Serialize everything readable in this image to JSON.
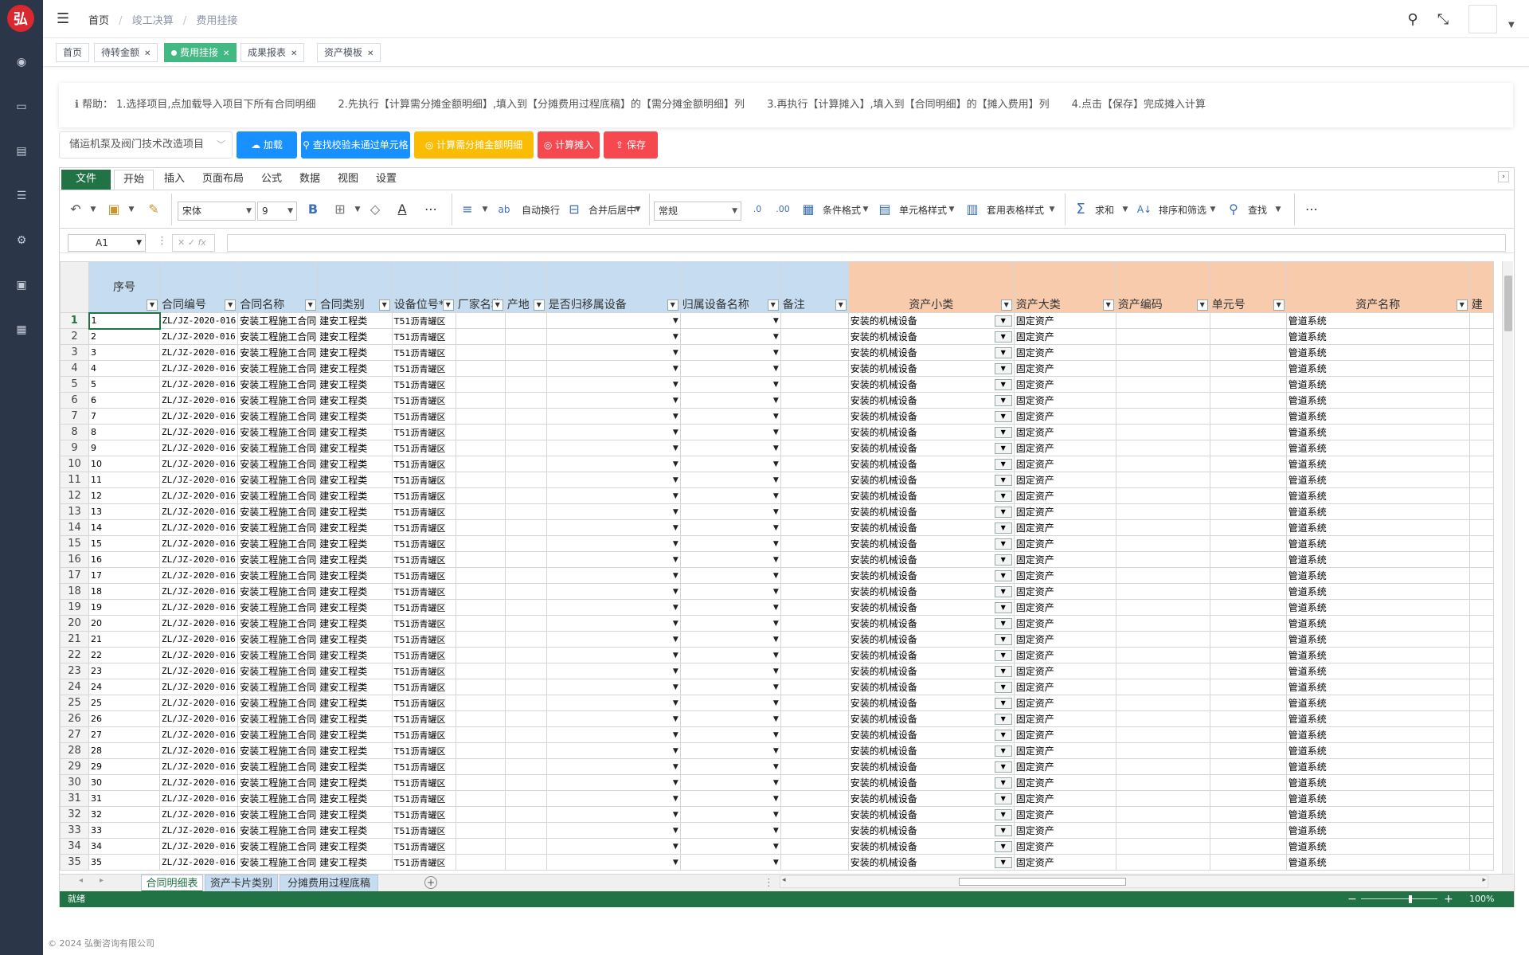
{
  "app": {
    "logo_text": "弘",
    "footer": "© 2024 弘衡咨询有限公司"
  },
  "breadcrumb": [
    "首页",
    "竣工决算",
    "费用挂接"
  ],
  "tags": [
    {
      "label": "首页",
      "active": false,
      "closable": false
    },
    {
      "label": "待转金额",
      "active": false,
      "closable": true
    },
    {
      "label": "费用挂接",
      "active": true,
      "closable": true
    },
    {
      "label": "成果报表",
      "active": false,
      "closable": true
    },
    {
      "label": "资产模板",
      "active": false,
      "closable": true
    }
  ],
  "help": {
    "prefix": "帮助：",
    "steps": [
      "1.选择项目,点加载导入项目下所有合同明细",
      "2.先执行【计算需分摊金额明细】,填入到【分摊费用过程底稿】的【需分摊金额明细】列",
      "3.再执行【计算摊入】,填入到【合同明细】的【摊入费用】列",
      "4.点击【保存】完成摊入计算"
    ]
  },
  "actions": {
    "project_value": "储运机泵及阀门技术改造项目",
    "buttons": [
      {
        "label": "加载",
        "icon": "☁",
        "color": "#1890ff"
      },
      {
        "label": "查找校验未通过单元格",
        "icon": "⚲",
        "color": "#1890ff"
      },
      {
        "label": "计算需分摊金额明细",
        "icon": "◎",
        "color": "#fbbc05"
      },
      {
        "label": "计算摊入",
        "icon": "◎",
        "color": "#f5484f"
      },
      {
        "label": "保存",
        "icon": "⇪",
        "color": "#f5484f"
      }
    ]
  },
  "ribbon": {
    "tabs": [
      "文件",
      "开始",
      "插入",
      "页面布局",
      "公式",
      "数据",
      "视图",
      "设置"
    ],
    "font_name": "宋体",
    "font_size": "9",
    "number_format": "常规",
    "labels": {
      "wrap": "自动换行",
      "merge": "合并后居中",
      "cond_format": "条件格式",
      "cell_style": "单元格样式",
      "table_style": "套用表格样式",
      "sum": "求和",
      "sort_filter": "排序和筛选",
      "find": "查找"
    }
  },
  "formula_bar": {
    "name_box": "A1",
    "fx": "fx"
  },
  "grid": {
    "columns": [
      {
        "label": "序号",
        "group": "blue",
        "filter": true
      },
      {
        "label": "合同编号",
        "group": "blue",
        "filter": true
      },
      {
        "label": "合同名称",
        "group": "blue",
        "filter": true
      },
      {
        "label": "合同类别",
        "group": "blue",
        "filter": true
      },
      {
        "label": "设备位号*",
        "group": "blue",
        "filter": true
      },
      {
        "label": "厂家名称",
        "group": "blue",
        "filter": true
      },
      {
        "label": "产地",
        "group": "blue",
        "filter": true
      },
      {
        "label": "是否归移属设备",
        "group": "blue",
        "filter": true
      },
      {
        "label": "归属设备名称",
        "group": "blue",
        "filter": true
      },
      {
        "label": "备注",
        "group": "blue",
        "filter": true
      },
      {
        "label": "资产小类",
        "group": "peach",
        "filter": true
      },
      {
        "label": "资产大类",
        "group": "peach",
        "filter": true
      },
      {
        "label": "资产编码",
        "group": "peach",
        "filter": true
      },
      {
        "label": "单元号",
        "group": "peach",
        "filter": true
      },
      {
        "label": "资产名称",
        "group": "peach",
        "filter": true
      },
      {
        "label": "建",
        "group": "peach",
        "filter": false
      }
    ],
    "row_defaults": {
      "contract_no": "ZL/JZ-2020-016",
      "contract_name": "安装工程施工合同",
      "contract_type": "建安工程类",
      "equipment_no": "T51沥青罐区",
      "asset_subclass": "安装的机械设备",
      "asset_class": "固定资产",
      "asset_name": "管道系统"
    },
    "row_count": 35
  },
  "sheets": [
    "合同明细表",
    "资产卡片类别",
    "分摊费用过程底稿"
  ],
  "status": {
    "text": "就绪",
    "zoom": "100%"
  }
}
